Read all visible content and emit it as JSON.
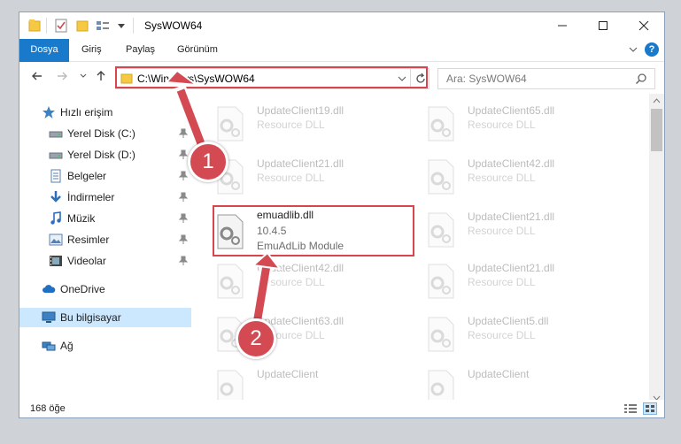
{
  "window": {
    "title": "SysWOW64",
    "controls": [
      "minimize",
      "maximize",
      "close"
    ]
  },
  "ribbon": {
    "tabs": [
      "Dosya",
      "Giriş",
      "Paylaş",
      "Görünüm"
    ],
    "help": "?"
  },
  "address": {
    "path": "C:\\Windows\\SysWOW64",
    "search_placeholder": "Ara: SysWOW64"
  },
  "sidebar": {
    "items": [
      {
        "label": "Hızlı erişim",
        "icon": "star-icon",
        "pinned": false
      },
      {
        "label": "Yerel Disk (C:)",
        "icon": "drive-icon",
        "pinned": true
      },
      {
        "label": "Yerel Disk (D:)",
        "icon": "drive-icon",
        "pinned": true
      },
      {
        "label": "Belgeler",
        "icon": "document-icon",
        "pinned": true
      },
      {
        "label": "İndirmeler",
        "icon": "download-icon",
        "pinned": true
      },
      {
        "label": "Müzik",
        "icon": "music-icon",
        "pinned": true
      },
      {
        "label": "Resimler",
        "icon": "picture-icon",
        "pinned": true
      },
      {
        "label": "Videolar",
        "icon": "video-icon",
        "pinned": true
      },
      {
        "label": "OneDrive",
        "icon": "cloud-icon",
        "pinned": false
      },
      {
        "label": "Bu bilgisayar",
        "icon": "computer-icon",
        "pinned": false,
        "selected": true
      },
      {
        "label": "Ağ",
        "icon": "network-icon",
        "pinned": false
      }
    ]
  },
  "files": [
    {
      "name": "UpdateClient19.dll",
      "sub1": "Resource DLL"
    },
    {
      "name": "UpdateClient65.dll",
      "sub1": "Resource DLL"
    },
    {
      "name": "UpdateClient21.dll",
      "sub1": "Resource DLL"
    },
    {
      "name": "UpdateClient42.dll",
      "sub1": "Resource DLL"
    },
    {
      "name": "emuadlib.dll",
      "sub1": "10.4.5",
      "sub2": "EmuAdLib Module",
      "highlighted": true
    },
    {
      "name": "UpdateClient21.dll",
      "sub1": "Resource DLL"
    },
    {
      "name": "UpdateClient42.dll",
      "sub1": "Resource DLL"
    },
    {
      "name": "UpdateClient21.dll",
      "sub1": "Resource DLL"
    },
    {
      "name": "UpdateClient63.dll",
      "sub1": "Resource DLL"
    },
    {
      "name": "UpdateClient5.dll",
      "sub1": "Resource DLL"
    },
    {
      "name": "UpdateClient",
      "sub1": ""
    },
    {
      "name": "UpdateClient",
      "sub1": ""
    }
  ],
  "status": {
    "count": "168 öğe"
  },
  "annotations": {
    "step1": "1",
    "step2": "2",
    "color": "#d34a52"
  },
  "colors": {
    "accent": "#1979ca",
    "folder": "#f6c945",
    "selection": "#cce8ff"
  }
}
